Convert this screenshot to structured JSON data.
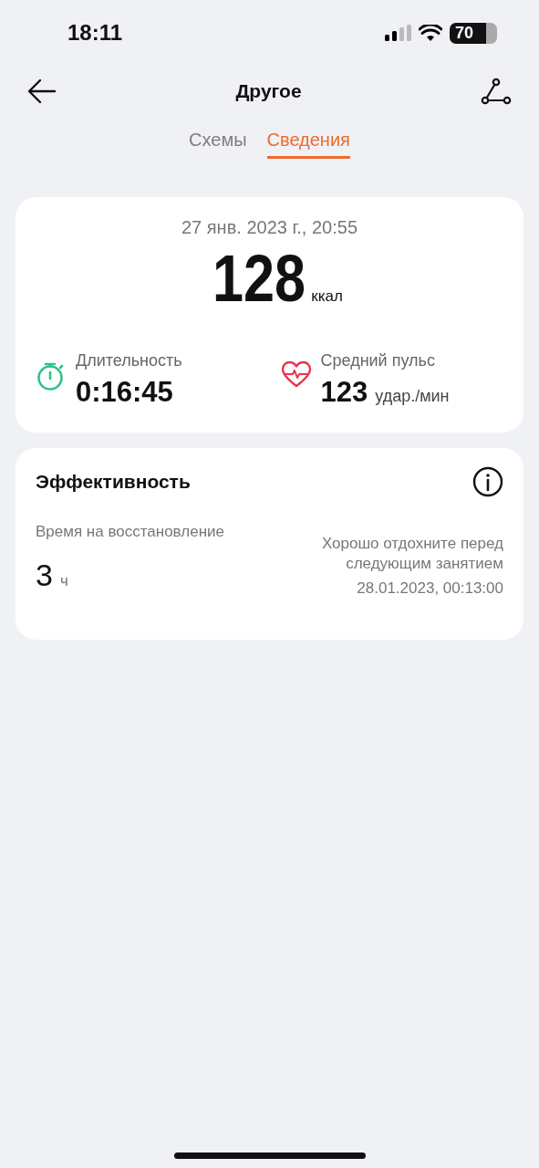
{
  "status_bar": {
    "time": "18:11",
    "battery": "70"
  },
  "header": {
    "title": "Другое"
  },
  "tabs": [
    {
      "label": "Схемы",
      "selected": false
    },
    {
      "label": "Сведения",
      "selected": true
    }
  ],
  "summary": {
    "date": "27 янв. 2023 г., 20:55",
    "calories": "128",
    "calories_unit": "ккал",
    "stats": [
      {
        "kind": "duration",
        "label": "Длительность",
        "value": "0:16:45"
      },
      {
        "kind": "pulse",
        "label": "Средний пульс",
        "value": "123",
        "unit": "удар./мин"
      }
    ]
  },
  "efficiency": {
    "title": "Эффективность",
    "recovery_label": "Время на восстановление",
    "recovery_value": "3",
    "recovery_unit": "ч",
    "advice": "Хорошо отдохните перед следующим занятием",
    "until": "28.01.2023, 00:13:00"
  }
}
